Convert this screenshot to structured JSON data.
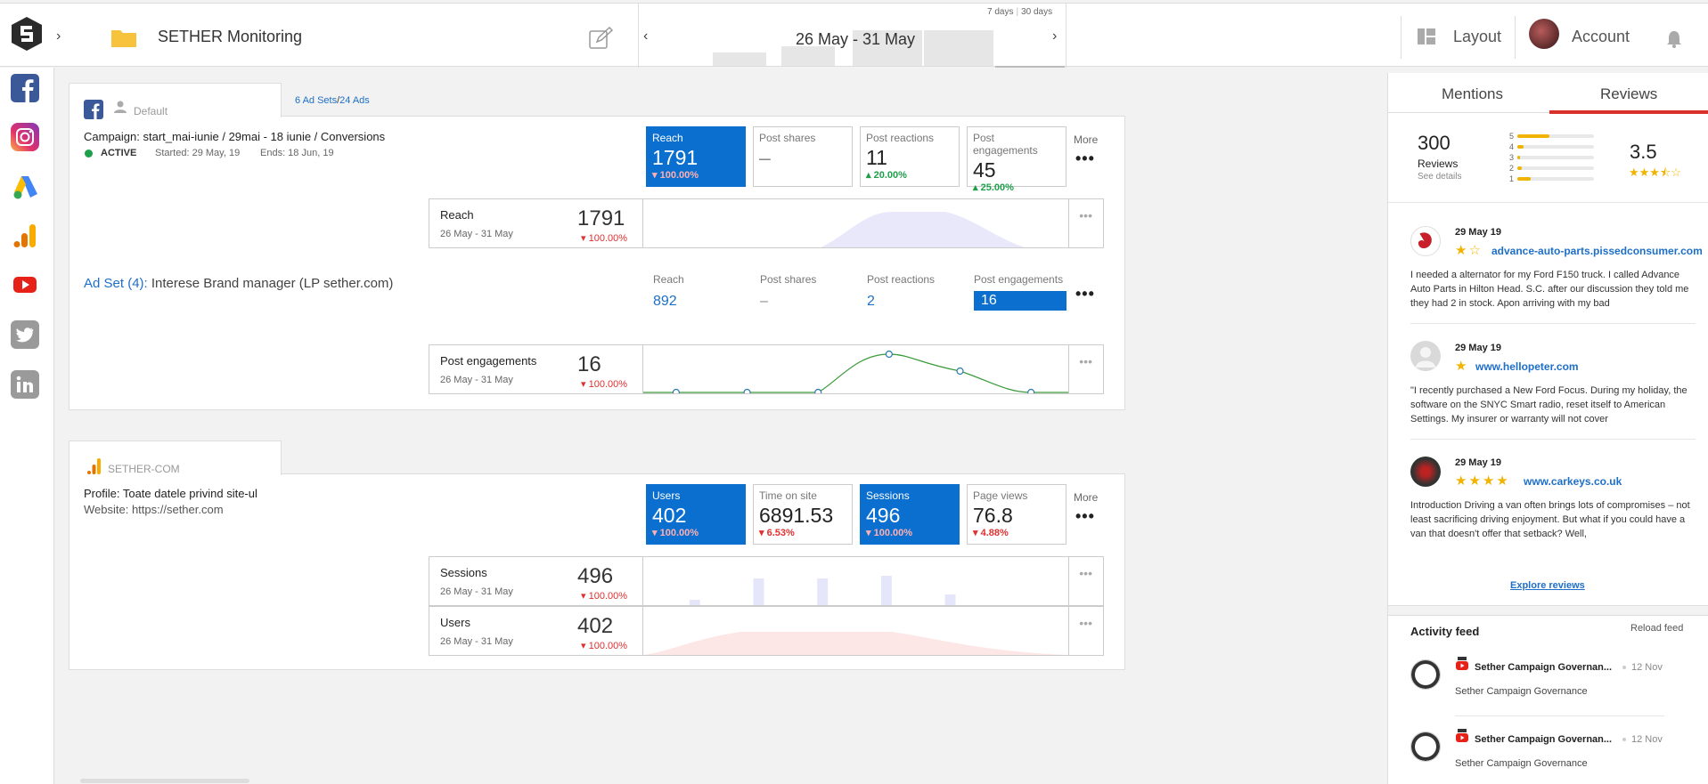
{
  "topbar": {
    "title": "SETHER Monitoring",
    "date_range": "26 May - 31 May",
    "range_7": "7 days",
    "range_30": "30 days",
    "layout_label": "Layout",
    "account_label": "Account"
  },
  "sidebar": {
    "items": [
      "facebook",
      "instagram",
      "google-ads",
      "google-analytics",
      "youtube",
      "twitter",
      "linkedin"
    ]
  },
  "facebook_card": {
    "tab_label": "Default",
    "adsets_link": "6 Ad Sets",
    "ads_link": "24 Ads",
    "link_sep": "/",
    "campaign": "Campaign: start_mai-iunie / 29mai - 18 iunie / Conversions",
    "status": "ACTIVE",
    "started": "Started: 29 May, 19",
    "ends": "Ends: 18 Jun, 19",
    "kpis": [
      {
        "label": "Reach",
        "value": "1791",
        "change": "100.00%",
        "dir": "down",
        "active": true
      },
      {
        "label": "Post shares",
        "value": "–",
        "change": "",
        "dir": "",
        "active": false
      },
      {
        "label": "Post reactions",
        "value": "11",
        "change": "20.00%",
        "dir": "up",
        "active": false
      },
      {
        "label": "Post engagements",
        "value": "45",
        "change": "25.00%",
        "dir": "up",
        "active": false
      }
    ],
    "more_label": "More",
    "reach_card": {
      "title": "Reach",
      "date": "26 May - 31 May",
      "value": "1791",
      "change": "100.00%"
    },
    "adset_prefix": "Ad Set (4):",
    "adset_name": "Interese Brand manager (LP sether.com)",
    "adset_cols": [
      {
        "label": "Reach",
        "value": "892"
      },
      {
        "label": "Post shares",
        "value": "–"
      },
      {
        "label": "Post reactions",
        "value": "2"
      },
      {
        "label": "Post engagements",
        "value": "16"
      }
    ],
    "eng_card": {
      "title": "Post engagements",
      "date": "26 May - 31 May",
      "value": "16",
      "change": "100.00%"
    }
  },
  "analytics_card": {
    "tab_label": "SETHER-COM",
    "profile": "Profile: Toate datele privind site-ul",
    "website": "Website: https://sether.com",
    "kpis": [
      {
        "label": "Users",
        "value": "402",
        "change": "100.00%",
        "dir": "down",
        "active": true
      },
      {
        "label": "Time on site",
        "value": "6891.53",
        "change": "6.53%",
        "dir": "down",
        "active": false
      },
      {
        "label": "Sessions",
        "value": "496",
        "change": "100.00%",
        "dir": "down",
        "active": true
      },
      {
        "label": "Page views",
        "value": "76.8",
        "change": "4.88%",
        "dir": "down",
        "active": false
      }
    ],
    "more_label": "More",
    "sessions_card": {
      "title": "Sessions",
      "date": "26 May - 31 May",
      "value": "496",
      "change": "100.00%"
    },
    "users_card": {
      "title": "Users",
      "date": "26 May - 31 May",
      "value": "402",
      "change": "100.00%"
    }
  },
  "right_panel": {
    "tab_mentions": "Mentions",
    "tab_reviews": "Reviews",
    "total_reviews": "300",
    "reviews_label": "Reviews",
    "see_details": "See details",
    "rating": "3.5",
    "star_dist": [
      {
        "star": "5",
        "fraction": 0.42
      },
      {
        "star": "4",
        "fraction": 0.08
      },
      {
        "star": "3",
        "fraction": 0.03
      },
      {
        "star": "2",
        "fraction": 0.06
      },
      {
        "star": "1",
        "fraction": 0.18
      }
    ],
    "reviews": [
      {
        "date": "29 May 19",
        "stars": "★☆",
        "site": "advance-auto-parts.pissedconsumer.com",
        "text": "I needed a alternator for my Ford F150 truck. I called Advance Auto Parts in Hilton Head. S.C. after our discussion they told me they had 2 in stock. Apon arriving with my bad"
      },
      {
        "date": "29 May 19",
        "stars": "★",
        "site": "www.hellopeter.com",
        "text": "\"I recently purchased a New Ford Focus. During my holiday, the software on the SNYC Smart radio, reset itself to American Settings. My insurer or warranty will not cover"
      },
      {
        "date": "29 May 19",
        "stars": "★★★★",
        "site": "www.carkeys.co.uk",
        "text": "Introduction Driving a van often brings lots of compromises – not least sacrificing driving enjoyment. But what if you could have a van that doesn't offer that setback? Well,"
      }
    ],
    "explore_label": "Explore reviews",
    "activity_title": "Activity feed",
    "reload_label": "Reload feed",
    "feed": [
      {
        "title": "Sether Campaign Governan...",
        "date": "12 Nov",
        "subtitle": "Sether Campaign Governance"
      },
      {
        "title": "Sether Campaign Governan...",
        "date": "12 Nov",
        "subtitle": "Sether Campaign Governance"
      }
    ]
  },
  "colors": {
    "accent": "#0b6fd0",
    "down": "#e03030",
    "up": "#1ea04a",
    "star": "#f0b400",
    "tab_active": "#d9302c"
  }
}
